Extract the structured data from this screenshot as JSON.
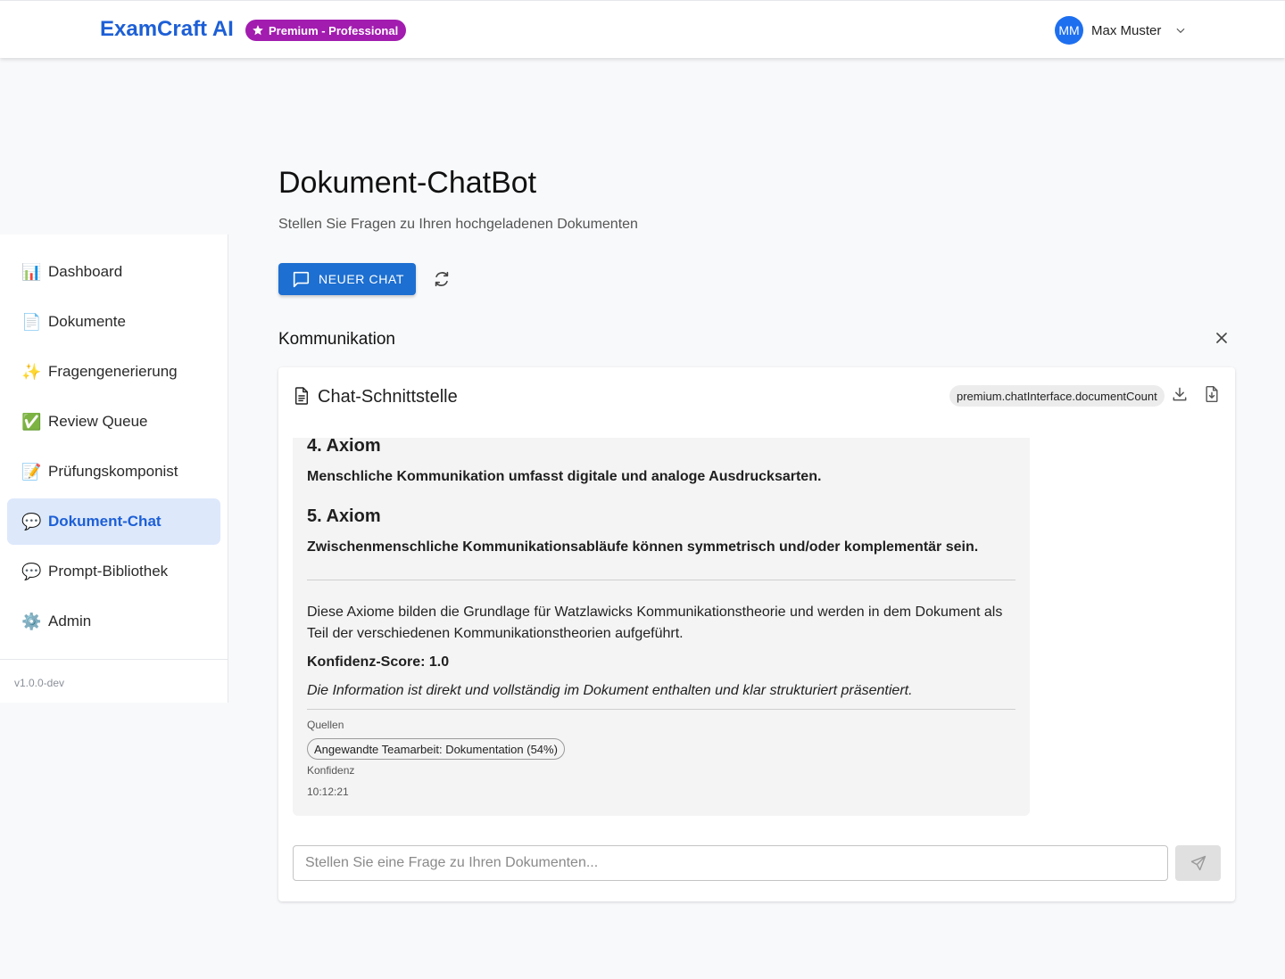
{
  "header": {
    "brand": "ExamCraft AI",
    "premium_badge": "Premium - Professional",
    "user_initials": "MM",
    "user_name": "Max Muster"
  },
  "sidebar": {
    "items": [
      {
        "icon": "📊",
        "icon_name": "bar-chart-icon",
        "label": "Dashboard"
      },
      {
        "icon": "📄",
        "icon_name": "document-icon",
        "label": "Dokumente"
      },
      {
        "icon": "✨",
        "icon_name": "sparkles-icon",
        "label": "Fragengenerierung"
      },
      {
        "icon": "✅",
        "icon_name": "checkmark-icon",
        "label": "Review Queue"
      },
      {
        "icon": "📝",
        "icon_name": "memo-icon",
        "label": "Prüfungskomponist"
      },
      {
        "icon": "💬",
        "icon_name": "speech-bubble-icon",
        "label": "Dokument-Chat",
        "active": true
      },
      {
        "icon": "💬",
        "icon_name": "speech-bubble-icon",
        "label": "Prompt-Bibliothek"
      },
      {
        "icon": "⚙️",
        "icon_name": "gear-icon",
        "label": "Admin"
      }
    ],
    "version": "v1.0.0-dev"
  },
  "page": {
    "title": "Dokument-ChatBot",
    "subtitle": "Stellen Sie Fragen zu Ihren hochgeladenen Dokumenten",
    "new_chat_label": "NEUER CHAT",
    "section_title": "Kommunikation"
  },
  "chat": {
    "title": "Chat-Schnittstelle",
    "document_count_chip": "premium.chatInterface.documentCount",
    "message": {
      "axiom4_heading": "4. Axiom",
      "axiom4_text": "Menschliche Kommunikation umfasst digitale und analoge Ausdrucksarten.",
      "axiom5_heading": "5. Axiom",
      "axiom5_text": "Zwischenmenschliche Kommunikationsabläufe können symmetrisch und/oder komplementär sein.",
      "summary": "Diese Axiome bilden die Grundlage für Watzlawicks Kommunikationstheorie und werden in dem Dokument als Teil der verschiedenen Kommunikationstheorien aufgeführt.",
      "confidence_score": "Konfidenz-Score: 1.0",
      "confidence_note": "Die Information ist direkt und vollständig im Dokument enthalten und klar strukturiert präsentiert.",
      "sources_label": "Quellen",
      "source_chip": "Angewandte Teamarbeit: Dokumentation (54%)",
      "confidence_label": "Konfidenz",
      "timestamp": "10:12:21"
    },
    "input_placeholder": "Stellen Sie eine Frage zu Ihren Dokumenten..."
  },
  "colors": {
    "brand": "#1d5fd6",
    "premium": "#a21caf",
    "primary_button": "#1d6fd1",
    "active_nav_bg": "#dde8fb"
  }
}
